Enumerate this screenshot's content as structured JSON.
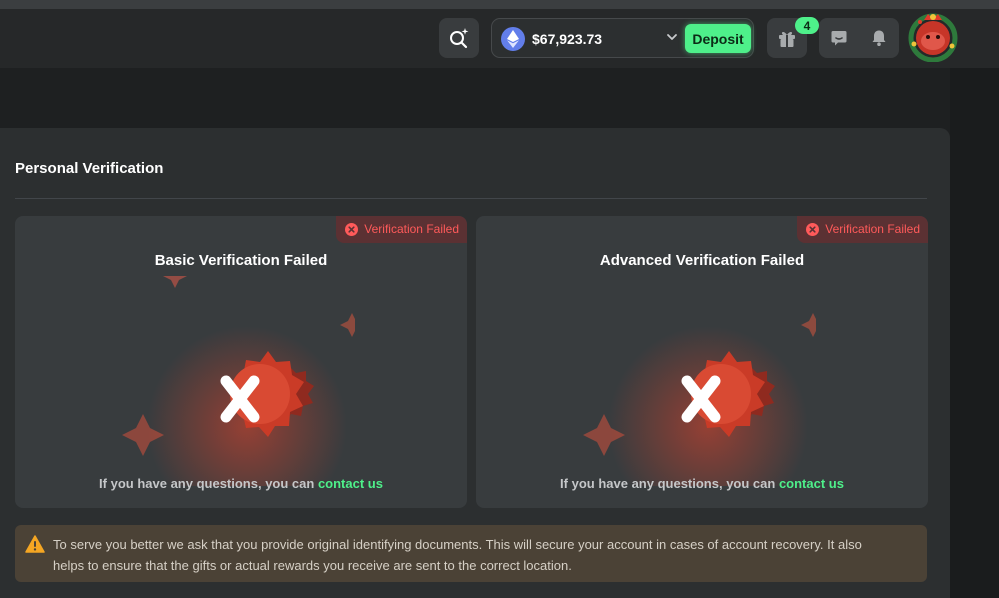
{
  "header": {
    "balance": "$67,923.73",
    "deposit_label": "Deposit",
    "gift_count": "4"
  },
  "page": {
    "title": "Personal Verification"
  },
  "cards": [
    {
      "status": "Verification Failed",
      "title": "Basic Verification Failed",
      "question": "If you have any questions, you can ",
      "contact": "contact us"
    },
    {
      "status": "Verification Failed",
      "title": "Advanced Verification Failed",
      "question": "If you have any questions, you can ",
      "contact": "contact us"
    }
  ],
  "notice": {
    "text": "To serve you better we ask that you provide original identifying documents. This will secure your account in cases of account recovery. It also helps to ensure that the gifts or actual rewards you receive are sent to the correct location."
  },
  "colors": {
    "accent": "#4ef08a",
    "error": "#ff5a5a",
    "warning": "#f5a623"
  }
}
